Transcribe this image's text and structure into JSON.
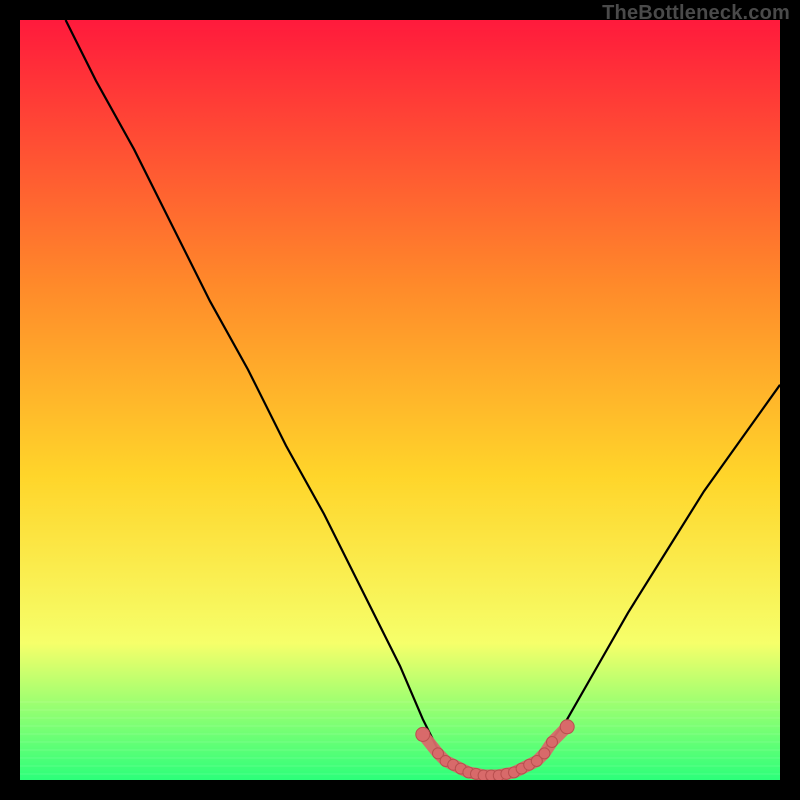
{
  "attribution": "TheBottleneck.com",
  "colors": {
    "bg": "#000000",
    "grad_top": "#ff1a3c",
    "grad_mid1": "#ff8a2a",
    "grad_mid2": "#ffd52a",
    "grad_mid3": "#f6ff6a",
    "grad_bottom": "#2cff7a",
    "curve": "#000000",
    "marker_fill": "#d86a6a",
    "marker_stroke": "#b94f4f"
  },
  "chart_data": {
    "type": "line",
    "title": "",
    "xlabel": "",
    "ylabel": "",
    "xlim": [
      0,
      100
    ],
    "ylim": [
      0,
      100
    ],
    "series": [
      {
        "name": "bottleneck-curve",
        "x": [
          6,
          10,
          15,
          20,
          25,
          30,
          35,
          40,
          45,
          50,
          53,
          55,
          57,
          59,
          61,
          63,
          65,
          67,
          69,
          72,
          76,
          80,
          85,
          90,
          95,
          100
        ],
        "y": [
          100,
          92,
          83,
          73,
          63,
          54,
          44,
          35,
          25,
          15,
          8,
          4,
          2,
          1,
          0.5,
          0.5,
          1,
          2,
          4,
          8,
          15,
          22,
          30,
          38,
          45,
          52
        ]
      }
    ],
    "markers": {
      "name": "highlighted-range",
      "x": [
        53,
        55,
        56,
        57,
        58,
        59,
        60,
        61,
        62,
        63,
        64,
        65,
        66,
        67,
        68,
        69,
        70,
        72
      ],
      "y": [
        6,
        3.5,
        2.5,
        2,
        1.5,
        1,
        0.8,
        0.6,
        0.6,
        0.6,
        0.8,
        1,
        1.5,
        2,
        2.5,
        3.5,
        5,
        7
      ]
    }
  }
}
